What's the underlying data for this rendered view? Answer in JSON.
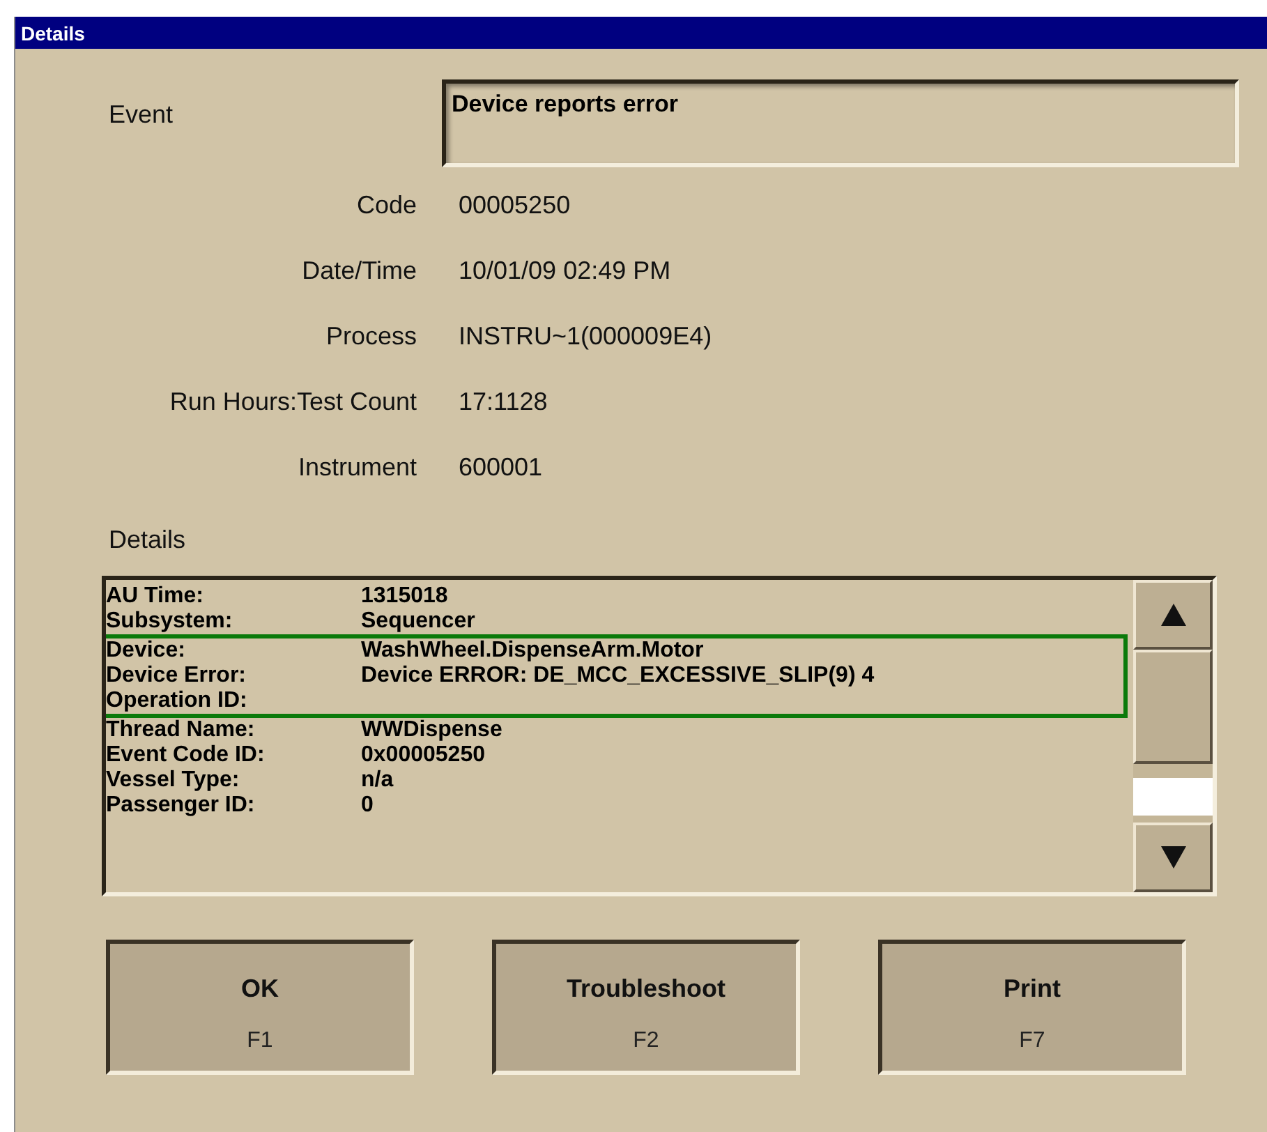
{
  "window": {
    "title": "Details"
  },
  "event": {
    "label": "Event",
    "value": "Device reports error"
  },
  "fields": [
    {
      "label": "Code",
      "value": "00005250"
    },
    {
      "label": "Date/Time",
      "value": "10/01/09 02:49 PM"
    },
    {
      "label": "Process",
      "value": "INSTRU~1(000009E4)"
    },
    {
      "label": "Run Hours:Test Count",
      "value": "17:1128"
    },
    {
      "label": "Instrument",
      "value": "600001"
    }
  ],
  "details": {
    "label": "Details",
    "rows": [
      {
        "label": "AU Time:",
        "value": "1315018",
        "highlighted": false
      },
      {
        "label": "Subsystem:",
        "value": "Sequencer",
        "highlighted": false
      },
      {
        "label": "Device:",
        "value": "WashWheel.DispenseArm.Motor",
        "highlighted": true
      },
      {
        "label": "Device Error:",
        "value": "Device ERROR: DE_MCC_EXCESSIVE_SLIP(9) 4",
        "highlighted": true
      },
      {
        "label": "Operation ID:",
        "value": "",
        "highlighted": true
      },
      {
        "label": "Thread Name:",
        "value": "WWDispense",
        "highlighted": false
      },
      {
        "label": "Event Code ID:",
        "value": "0x00005250",
        "highlighted": false
      },
      {
        "label": "Vessel Type:",
        "value": "n/a",
        "highlighted": false
      },
      {
        "label": "Passenger ID:",
        "value": "0",
        "highlighted": false
      }
    ]
  },
  "buttons": [
    {
      "label": "OK",
      "key": "F1"
    },
    {
      "label": "Troubleshoot",
      "key": "F2"
    },
    {
      "label": "Print",
      "key": "F7"
    }
  ]
}
